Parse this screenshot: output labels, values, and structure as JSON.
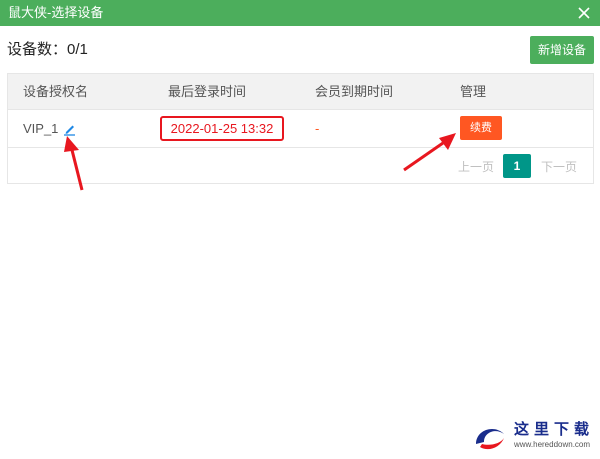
{
  "window": {
    "title": "鼠大侠-选择设备"
  },
  "header": {
    "count_label": "设备数：0/1",
    "add_button": "新增设备"
  },
  "table": {
    "columns": [
      "设备授权名",
      "最后登录时间",
      "会员到期时间",
      "管理"
    ],
    "rows": [
      {
        "name": "VIP_1",
        "last_login": "2022-01-25 13:32",
        "expire": "-",
        "action": "续费"
      }
    ]
  },
  "pagination": {
    "prev": "上一页",
    "current": "1",
    "next": "下一页"
  },
  "colors": {
    "titlebar": "#4cae5c",
    "accent_orange": "#ff5722",
    "page_active": "#009688",
    "annotation_red": "#e8171f"
  },
  "watermark": {
    "text": "这里下载",
    "url": "www.hereddown.com"
  }
}
